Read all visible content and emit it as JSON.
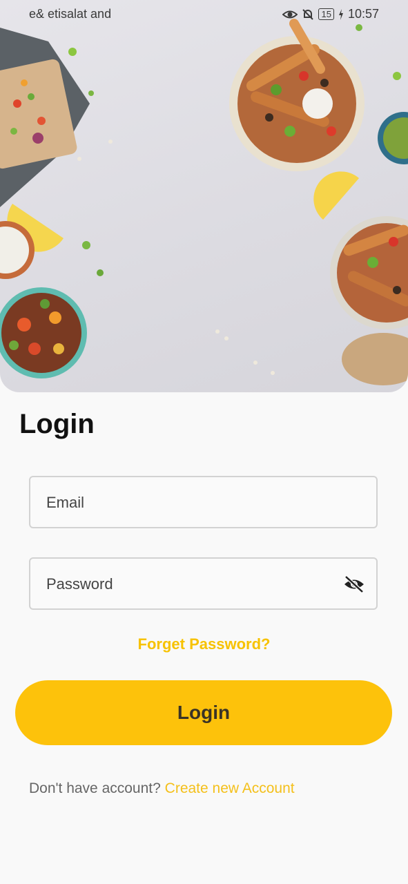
{
  "status_bar": {
    "carrier": "e& etisalat and",
    "battery": "15",
    "time": "10:57"
  },
  "hero": {
    "image_icon": "food-bowls-photo-icon"
  },
  "login_form": {
    "title": "Login",
    "email_placeholder": "Email",
    "password_placeholder": "Password",
    "visibility_icon": "eye-off-icon",
    "forgot_password": "Forget Password?",
    "login_button": "Login"
  },
  "signup": {
    "prompt": "Don't have account?",
    "link": "Create new Account"
  },
  "colors": {
    "accent": "#fdc20b",
    "link": "#f4c01b"
  }
}
